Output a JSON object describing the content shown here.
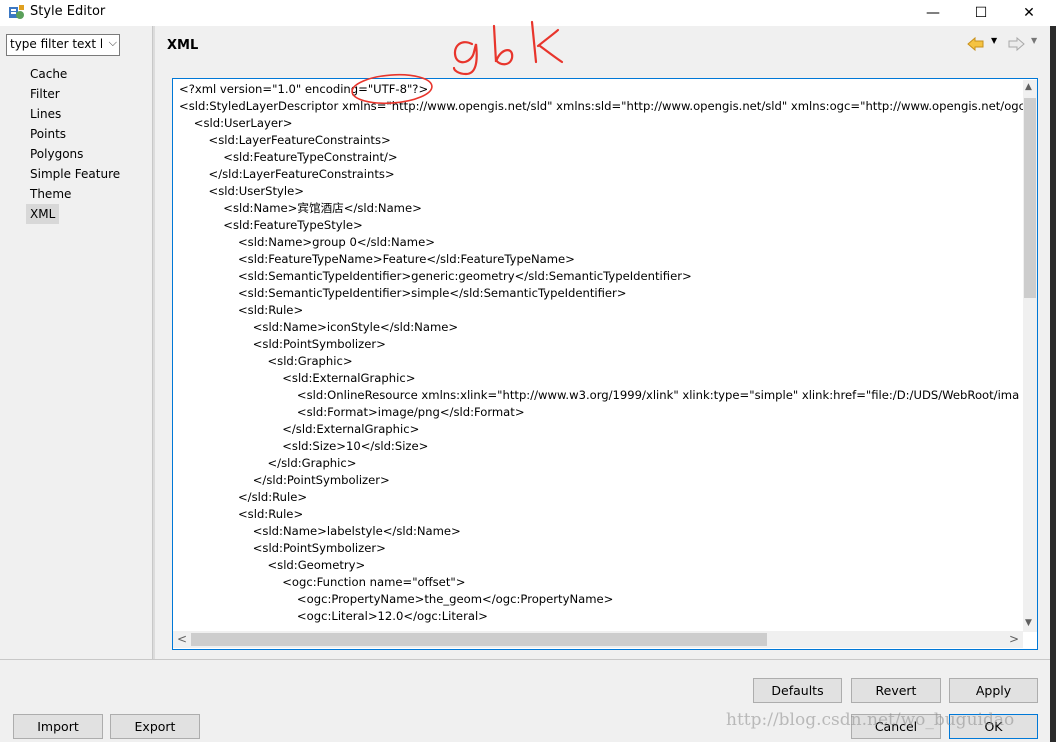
{
  "window": {
    "title": "Style Editor",
    "min_glyph": "—",
    "max_glyph": "☐",
    "close_glyph": "✕"
  },
  "filter": {
    "value": "type filter text h",
    "arrow": "⌵"
  },
  "tree": {
    "items": [
      "Cache",
      "Filter",
      "Lines",
      "Points",
      "Polygons",
      "Simple Feature",
      "Theme",
      "XML"
    ],
    "selected": "XML"
  },
  "page": {
    "title": "XML",
    "dropdown_glyph": "▼"
  },
  "editor": {
    "lines": [
      "<?xml version=\"1.0\" encoding=\"UTF-8\"?>",
      "<sld:StyledLayerDescriptor xmlns=\"http://www.opengis.net/sld\" xmlns:sld=\"http://www.opengis.net/sld\" xmlns:ogc=\"http://www.opengis.net/ogc\"",
      "    <sld:UserLayer>",
      "        <sld:LayerFeatureConstraints>",
      "            <sld:FeatureTypeConstraint/>",
      "        </sld:LayerFeatureConstraints>",
      "        <sld:UserStyle>",
      "            <sld:Name>宾馆酒店</sld:Name>",
      "            <sld:FeatureTypeStyle>",
      "                <sld:Name>group 0</sld:Name>",
      "                <sld:FeatureTypeName>Feature</sld:FeatureTypeName>",
      "                <sld:SemanticTypeIdentifier>generic:geometry</sld:SemanticTypeIdentifier>",
      "                <sld:SemanticTypeIdentifier>simple</sld:SemanticTypeIdentifier>",
      "                <sld:Rule>",
      "                    <sld:Name>iconStyle</sld:Name>",
      "                    <sld:PointSymbolizer>",
      "                        <sld:Graphic>",
      "                            <sld:ExternalGraphic>",
      "                                <sld:OnlineResource xmlns:xlink=\"http://www.w3.org/1999/xlink\" xlink:type=\"simple\" xlink:href=\"file:/D:/UDS/WebRoot/ima",
      "                                <sld:Format>image/png</sld:Format>",
      "                            </sld:ExternalGraphic>",
      "                            <sld:Size>10</sld:Size>",
      "                        </sld:Graphic>",
      "                    </sld:PointSymbolizer>",
      "                </sld:Rule>",
      "                <sld:Rule>",
      "                    <sld:Name>labelstyle</sld:Name>",
      "                    <sld:PointSymbolizer>",
      "                        <sld:Geometry>",
      "                            <ogc:Function name=\"offset\">",
      "                                <ogc:PropertyName>the_geom</ogc:PropertyName>",
      "                                <ogc:Literal>12.0</ogc:Literal>"
    ]
  },
  "scroll": {
    "up": "▲",
    "down": "▼",
    "left": "<",
    "right": ">"
  },
  "buttons": {
    "defaults": "Defaults",
    "revert": "Revert",
    "apply": "Apply",
    "import": "Import",
    "export": "Export",
    "cancel": "Cancel",
    "ok": "OK"
  },
  "annotation": {
    "handwritten": "gbk"
  },
  "watermark": "http://blog.csdn.net/wo_buguidao",
  "colors": {
    "annotation_red": "#e8352c",
    "focus_blue": "#0078d7"
  }
}
